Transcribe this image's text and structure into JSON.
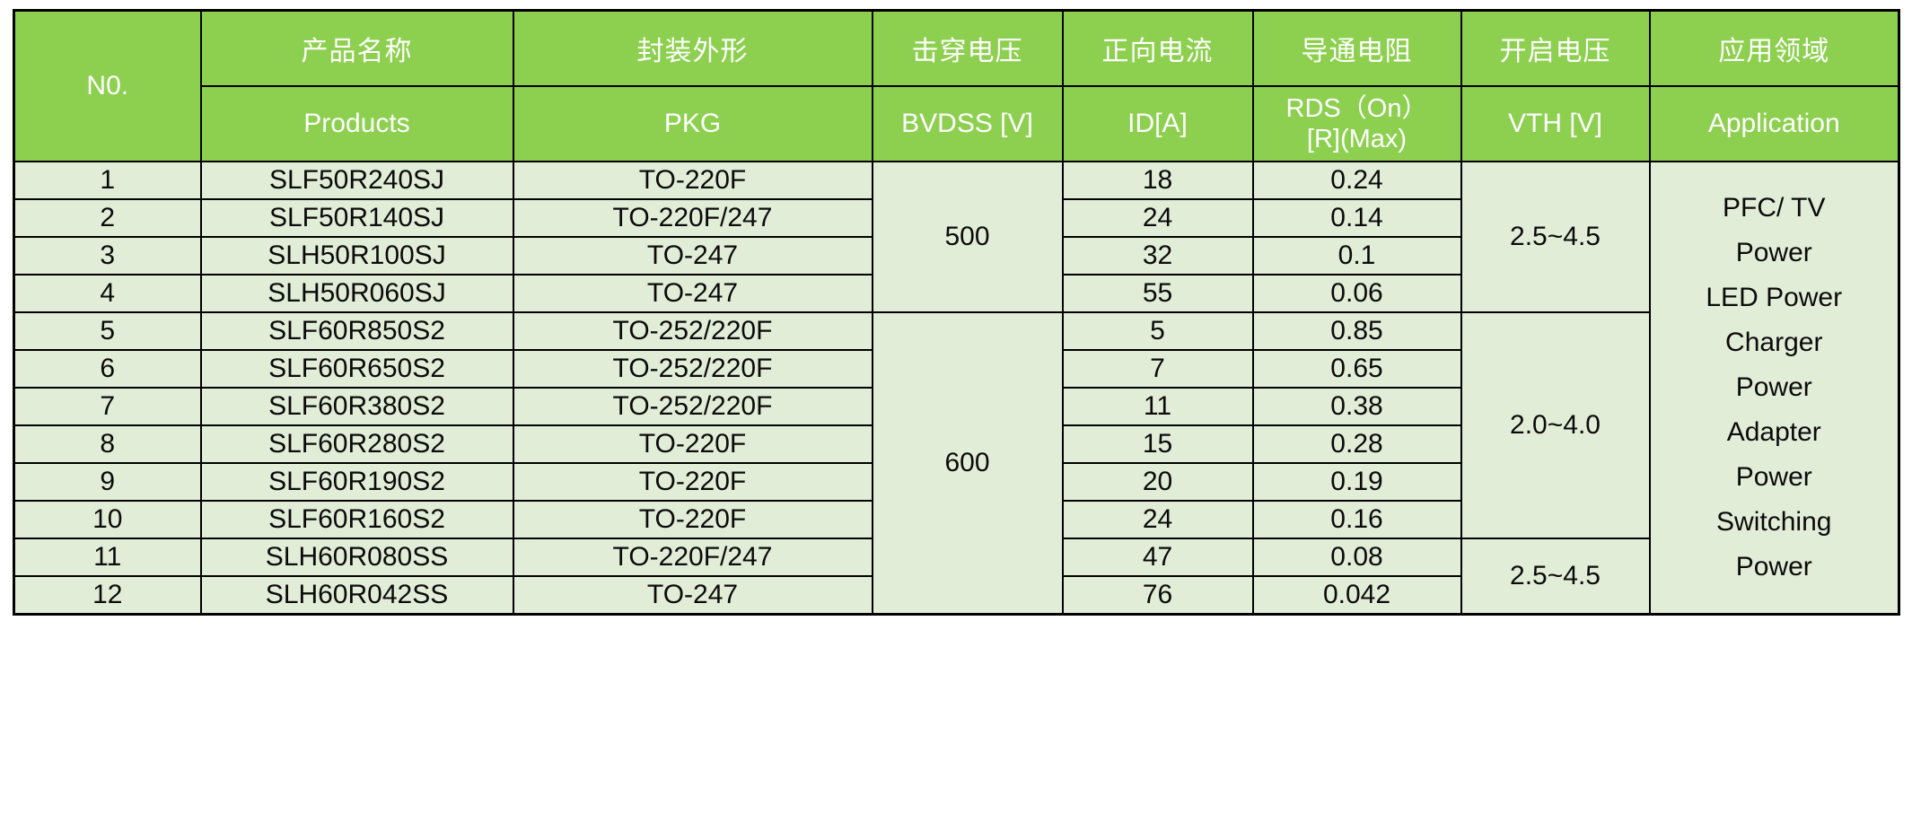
{
  "table": {
    "headers_cn": {
      "no": "N0.",
      "products": "产品名称",
      "pkg": "封装外形",
      "bvdss": "击穿电压",
      "id": "正向电流",
      "rds": "导通电阻",
      "vth": "开启电压",
      "application": "应用领域"
    },
    "headers_en": {
      "products": "Products",
      "pkg": "PKG",
      "bvdss": "BVDSS [V]",
      "id": "ID[A]",
      "rds_line1": "RDS（On）",
      "rds_line2": "[R](Max)",
      "vth": "VTH [V]",
      "application": "Application"
    },
    "rows": [
      {
        "no": "1",
        "product": "SLF50R240SJ",
        "pkg": "TO-220F",
        "id": "18",
        "rds": "0.24"
      },
      {
        "no": "2",
        "product": "SLF50R140SJ",
        "pkg": "TO-220F/247",
        "id": "24",
        "rds": "0.14"
      },
      {
        "no": "3",
        "product": "SLH50R100SJ",
        "pkg": "TO-247",
        "id": "32",
        "rds": "0.1"
      },
      {
        "no": "4",
        "product": "SLH50R060SJ",
        "pkg": "TO-247",
        "id": "55",
        "rds": "0.06"
      },
      {
        "no": "5",
        "product": "SLF60R850S2",
        "pkg": "TO-252/220F",
        "id": "5",
        "rds": "0.85"
      },
      {
        "no": "6",
        "product": "SLF60R650S2",
        "pkg": "TO-252/220F",
        "id": "7",
        "rds": "0.65"
      },
      {
        "no": "7",
        "product": "SLF60R380S2",
        "pkg": "TO-252/220F",
        "id": "11",
        "rds": "0.38"
      },
      {
        "no": "8",
        "product": "SLF60R280S2",
        "pkg": "TO-220F",
        "id": "15",
        "rds": "0.28"
      },
      {
        "no": "9",
        "product": "SLF60R190S2",
        "pkg": "TO-220F",
        "id": "20",
        "rds": "0.19"
      },
      {
        "no": "10",
        "product": "SLF60R160S2",
        "pkg": "TO-220F",
        "id": "24",
        "rds": "0.16"
      },
      {
        "no": "11",
        "product": "SLH60R080SS",
        "pkg": "TO-220F/247",
        "id": "47",
        "rds": "0.08"
      },
      {
        "no": "12",
        "product": "SLH60R042SS",
        "pkg": "TO-247",
        "id": "76",
        "rds": "0.042"
      }
    ],
    "bvdss_groups": [
      {
        "value": "500",
        "rowspan": 4
      },
      {
        "value": "600",
        "rowspan": 8
      }
    ],
    "vth_groups": [
      {
        "value": "2.5~4.5",
        "rowspan": 4
      },
      {
        "value": "2.0~4.0",
        "rowspan": 6
      },
      {
        "value": "2.5~4.5",
        "rowspan": 2
      }
    ],
    "application": {
      "rowspan": 12,
      "lines": [
        "PFC/ TV",
        "Power",
        "LED Power",
        "Charger",
        "Power",
        "Adapter",
        "Power",
        "Switching",
        "Power"
      ]
    },
    "colors": {
      "header_green": "#8DD04F",
      "cell_green": "#E2EDD8",
      "border": "#000000",
      "header_text": "#FFFFFF",
      "cell_text": "#0B0B0B"
    }
  }
}
